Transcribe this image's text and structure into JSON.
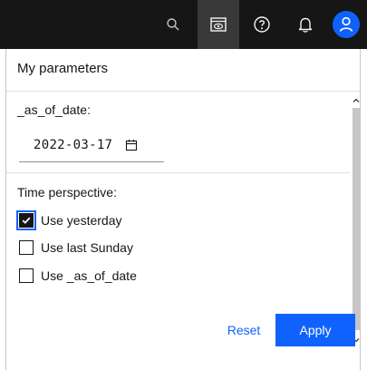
{
  "topbar": {
    "icons": [
      "search-icon",
      "screen-icon",
      "help-icon",
      "notification-icon",
      "user-avatar-icon"
    ],
    "accent": "#0f62fe"
  },
  "panel": {
    "title": "My parameters",
    "as_of_date": {
      "label": "_as_of_date:",
      "value": "2022-03-17"
    },
    "time_perspective": {
      "label": "Time perspective:",
      "options": [
        {
          "label": "Use yesterday",
          "checked": true
        },
        {
          "label": "Use last Sunday",
          "checked": false
        },
        {
          "label": "Use _as_of_date",
          "checked": false
        }
      ]
    },
    "actions": {
      "reset_label": "Reset",
      "apply_label": "Apply"
    }
  }
}
